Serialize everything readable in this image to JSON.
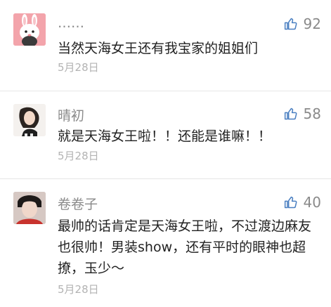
{
  "comments": [
    {
      "username": "……",
      "likes": "92",
      "text": "当然天海女王还有我宝家的姐姐们",
      "date": "5月28日"
    },
    {
      "username": "晴初",
      "likes": "58",
      "text": "就是天海女王啦！！还能是谁嘛！！",
      "date": "5月28日"
    },
    {
      "username": "卷卷子",
      "likes": "40",
      "text": "最帅的话肯定是天海女王啦，不过渡边麻友也很帅！男装show，还有平时的眼神也超撩，玉少～",
      "date": "5月28日"
    }
  ],
  "icons": {
    "like": "thumbs-up-icon"
  },
  "colors": {
    "like_icon": "#4a7fc1",
    "meta_text": "#8a8a8a",
    "date_text": "#b3b3b3"
  }
}
